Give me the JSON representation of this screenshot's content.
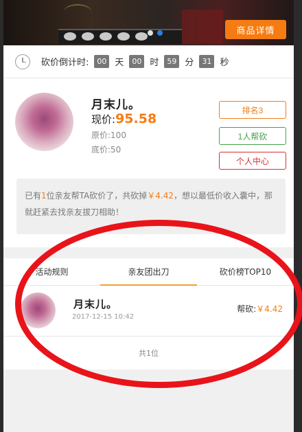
{
  "banner": {
    "detail_button": "商品详情",
    "colors": {
      "accent": "#f57c12",
      "dot_active": "#2b7de0"
    }
  },
  "countdown": {
    "label": "砍价倒计时:",
    "days": "00",
    "day_unit": "天",
    "hours": "00",
    "hour_unit": "时",
    "minutes": "59",
    "minute_unit": "分",
    "seconds": "31",
    "second_unit": "秒"
  },
  "product": {
    "name": "月末儿。",
    "cut_label": "现价:",
    "cut_price": "95.58",
    "original_price": "原价:100",
    "floor_price": "底价:50"
  },
  "actions": {
    "rank": "排名3",
    "helpers": "1人帮砍",
    "personal_center": "个人中心"
  },
  "tip": {
    "prefix": "已有",
    "count": "1",
    "middle": "位亲友帮TA砍价了，共砍掉",
    "amount": "￥4.42",
    "suffix": "，想以最低价收入囊中，那就赶紧去找亲友拔刀相助！"
  },
  "tabs": [
    "活动规则",
    "亲友团出刀",
    "砍价榜TOP10"
  ],
  "helpers_list": [
    {
      "name": "月末儿。",
      "time": "2017-12-15 10:42",
      "help_label": "帮砍:",
      "help_amount": "￥4.42"
    }
  ],
  "total": "共1位"
}
